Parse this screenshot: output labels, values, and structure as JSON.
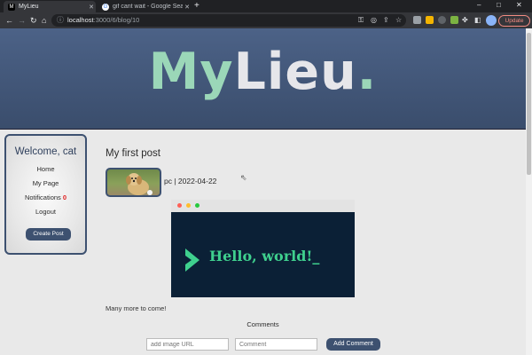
{
  "browser": {
    "tabs": [
      {
        "title": "MyLieu",
        "favicon": "M",
        "active": true
      },
      {
        "title": "gif cant wait - Google Search",
        "favicon": "G",
        "active": false
      }
    ],
    "new_tab": "+",
    "url_host": "localhost",
    "url_path": ":3000/6/blog/10",
    "update_label": "Update",
    "window_controls": [
      "–",
      "□",
      "✕"
    ],
    "colors": {
      "tab_bar": "#202124",
      "toolbar": "#35363a"
    }
  },
  "site": {
    "logo": {
      "part1": "My",
      "part2": "Lieu",
      "part3": "."
    },
    "colors": {
      "brand_navy": "#3d5170",
      "brand_mint": "#9bd7b8",
      "badge_red": "#e02020"
    }
  },
  "sidebar": {
    "welcome": "Welcome, cat",
    "links": [
      {
        "label": "Home"
      },
      {
        "label": "My Page"
      },
      {
        "label": "Notifications",
        "badge": "0"
      },
      {
        "label": "Logout"
      }
    ],
    "create_post": "Create Post"
  },
  "post": {
    "title": "My first post",
    "author": "pc",
    "separator": " | ",
    "date": "2022-04-22",
    "image_text": "Hello, world!_",
    "body": "Many more to come!"
  },
  "comments": {
    "heading": "Comments",
    "image_url_placeholder": "add image URL",
    "comment_placeholder": "Comment",
    "submit": "Add Comment"
  }
}
